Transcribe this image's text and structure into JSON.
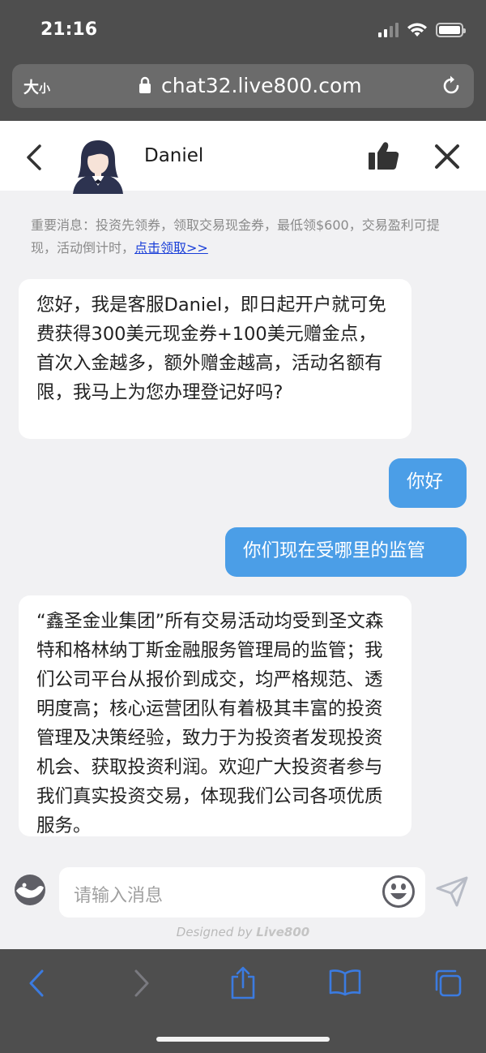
{
  "status_bar": {
    "time": "21:16"
  },
  "browser": {
    "text_size_label": "大",
    "text_size_small": "小",
    "url": "chat32.live800.com"
  },
  "chat_header": {
    "agent_name": "Daniel"
  },
  "notice": {
    "text": "重要消息：投资先领券，领取交易现金券，最低领$600，交易盈利可提现，活动倒计时，",
    "link_text": "点击领取>>"
  },
  "messages": [
    {
      "sender": "agent",
      "text": "您好，我是客服Daniel，即日起开户就可免费获得300美元现金券+100美元赠金点，首次入金越多，额外赠金越高，活动名额有限，我马上为您办理登记好吗?"
    },
    {
      "sender": "user",
      "text": "你好"
    },
    {
      "sender": "user",
      "text": "你们现在受哪里的监管"
    },
    {
      "sender": "agent",
      "text": "“鑫圣金业集团”所有交易活动均受到圣文森特和格林纳丁斯金融服务管理局的监管；我们公司平台从报价到成交，均严格规范、透明度高；核心运营团队有着极其丰富的投资管理及决策经验，致力于为投资者发现投资机会、获取投资利润。欢迎广大投资者参与我们真实投资交易，体现我们公司各项优质服务。"
    }
  ],
  "input": {
    "placeholder": "请输入消息"
  },
  "footer": {
    "designed_by": "Designed by",
    "brand": "Live800"
  },
  "colors": {
    "chrome": "#4e4e4e",
    "user_bubble": "#4b9ee7",
    "link": "#1a3fd8",
    "toolbar_icon": "#3b7be0"
  },
  "icons": {
    "back": "chevron-left-icon",
    "like": "thumbs-up-icon",
    "close": "close-icon",
    "lock": "lock-icon",
    "reload": "reload-icon",
    "emoji": "emoji-icon",
    "send": "send-icon",
    "mode": "mode-toggle-icon",
    "browser_back": "browser-back-icon",
    "browser_forward": "browser-forward-icon",
    "share": "share-icon",
    "bookmarks": "bookmarks-icon",
    "tabs": "tabs-icon"
  }
}
